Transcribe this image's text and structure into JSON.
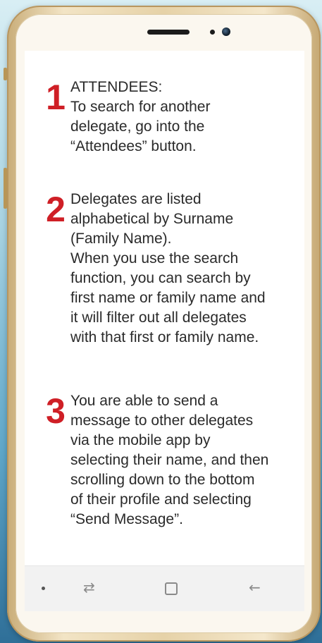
{
  "steps": [
    {
      "number": "1",
      "lines": [
        "ATTENDEES:",
        "To search for another",
        "delegate, go into the",
        "“Attendees” button."
      ]
    },
    {
      "number": "2",
      "lines": [
        "Delegates are listed",
        "alphabetical by Surname",
        "(Family Name).",
        "When you use the search",
        "function, you can search by",
        "first name or family name and",
        "it will filter out all delegates",
        "with that first or family name."
      ]
    },
    {
      "number": "3",
      "lines": [
        "You are able to send a",
        "message to other delegates",
        "via the mobile app by",
        "selecting their name, and then",
        "scrolling down to the bottom",
        "of their profile and selecting",
        "“Send Message”."
      ]
    }
  ],
  "navbar": {
    "switch_icon_glyph": "⇄",
    "back_icon_glyph": "←"
  },
  "colors": {
    "accent": "#cf1f26",
    "text": "#2a2a2a",
    "phone_frame": "#e6d2a8"
  }
}
